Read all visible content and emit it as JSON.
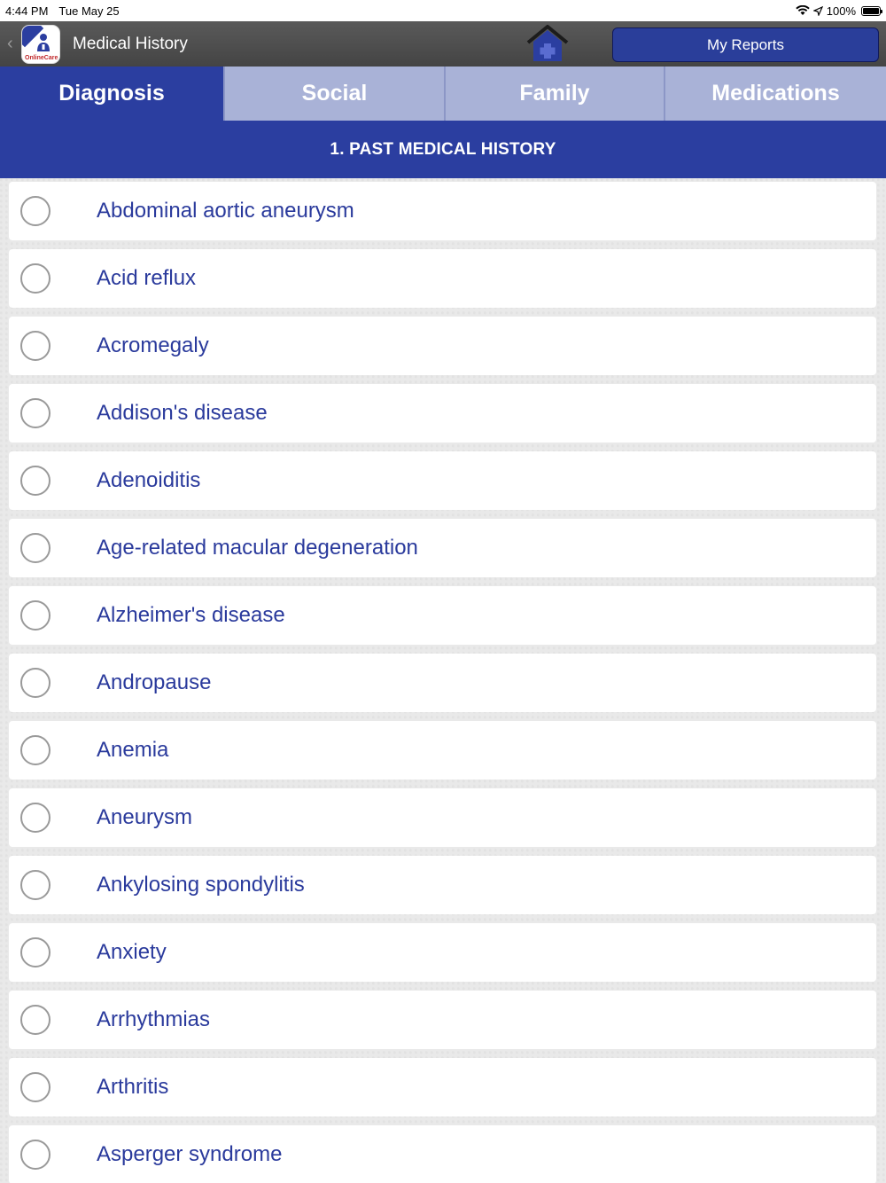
{
  "status": {
    "time": "4:44 PM",
    "date": "Tue May 25",
    "battery": "100%"
  },
  "nav": {
    "title": "Medical History",
    "logo_text": "OnlineCare",
    "reports_label": "My Reports"
  },
  "tabs": [
    {
      "label": "Diagnosis",
      "active": true
    },
    {
      "label": "Social",
      "active": false
    },
    {
      "label": "Family",
      "active": false
    },
    {
      "label": "Medications",
      "active": false
    }
  ],
  "section": {
    "title": "1. PAST MEDICAL HISTORY"
  },
  "conditions": [
    {
      "label": "Abdominal aortic aneurysm",
      "checked": false
    },
    {
      "label": "Acid reflux",
      "checked": false
    },
    {
      "label": "Acromegaly",
      "checked": false
    },
    {
      "label": "Addison's disease",
      "checked": false
    },
    {
      "label": "Adenoiditis",
      "checked": false
    },
    {
      "label": "Age-related macular degeneration",
      "checked": false
    },
    {
      "label": "Alzheimer's disease",
      "checked": false
    },
    {
      "label": "Andropause",
      "checked": false
    },
    {
      "label": "Anemia",
      "checked": false
    },
    {
      "label": "Aneurysm",
      "checked": false
    },
    {
      "label": "Ankylosing spondylitis",
      "checked": false
    },
    {
      "label": "Anxiety",
      "checked": false
    },
    {
      "label": "Arrhythmias",
      "checked": false
    },
    {
      "label": "Arthritis",
      "checked": false
    },
    {
      "label": "Asperger syndrome",
      "checked": false
    }
  ],
  "colors": {
    "brand_blue": "#2b3ea0",
    "tab_inactive": "#a9b2d7",
    "item_text": "#2a3a9c"
  },
  "icons": {
    "back": "chevron-left-icon",
    "home": "home-plus-icon",
    "wifi": "wifi-icon",
    "location": "location-arrow-icon",
    "battery": "battery-icon"
  }
}
